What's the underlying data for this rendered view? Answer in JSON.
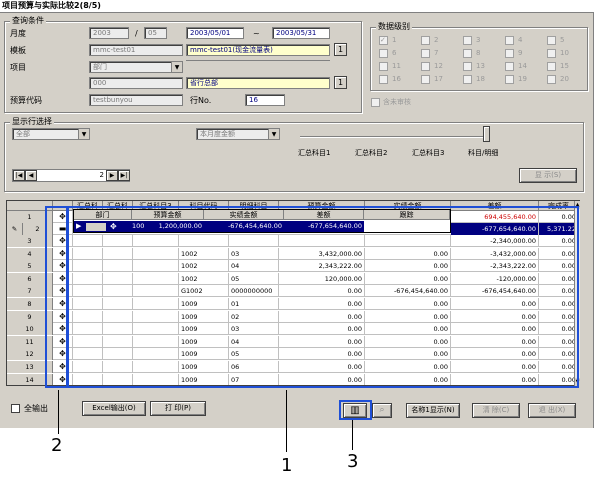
{
  "window": {
    "title": "项目预算与实际比较2(8/5)"
  },
  "query": {
    "group_title": "查询条件",
    "month_label": "月度",
    "year_value": "2003",
    "slash": "/",
    "month_value": "05",
    "date_from": "2003/05/01",
    "tilde": "~",
    "date_to": "2003/05/31",
    "template_label": "模板",
    "template_code": "mmc-test01",
    "template_name": "mmc-test01(现金流量表)",
    "project_label": "项目",
    "project_select": "部门",
    "project_code": "000",
    "project_name": "省行总部",
    "budget_code_label": "预算代码",
    "budget_code": "testbunyou",
    "row_no_label": "行No.",
    "row_no": "16",
    "lookup_label": "1"
  },
  "data_level": {
    "title": "数据级别",
    "levels": [
      "1",
      "2",
      "3",
      "4",
      "5",
      "6",
      "7",
      "8",
      "9",
      "10",
      "11",
      "12",
      "13",
      "14",
      "15",
      "16",
      "17",
      "18",
      "19",
      "20"
    ],
    "checked": [
      "1"
    ],
    "unaudited_label": "含未审核"
  },
  "display": {
    "title": "显示行选择",
    "select_all": "全部",
    "amount_type": "本月度金额",
    "slider_labels": [
      "汇总科目1",
      "汇总科目2",
      "汇总科目3",
      "科目/明细"
    ],
    "nav_value": "2",
    "show_button": "显 示(S)"
  },
  "grid": {
    "headers": [
      "",
      "",
      "汇总科",
      "汇总科",
      "汇总科目3",
      "科目代码",
      "明细科目",
      "预算金额",
      "实绩金额",
      "差额",
      "完成率"
    ],
    "sub_headers": [
      "部门",
      "预算金额",
      "实绩金额",
      "差额",
      "跟踪"
    ],
    "sub_row": {
      "code": "100",
      "budget": "1,200,000.00",
      "actual": "-676,454,640.00",
      "diff": "-677,654,640.00"
    },
    "row1_diff": "694,455,640.00",
    "row1_rate": "0.00",
    "row2_diff": "-677,654,640.00",
    "row2_rate": "5,371.22",
    "rows": [
      {
        "no": "3",
        "code": "",
        "detail": "",
        "budget": "",
        "actual": "",
        "diff": "-2,340,000.00",
        "rate": "0.00"
      },
      {
        "no": "4",
        "code": "1002",
        "detail": "03",
        "budget": "3,432,000.00",
        "actual": "0.00",
        "diff": "-3,432,000.00",
        "rate": "0.00"
      },
      {
        "no": "5",
        "code": "1002",
        "detail": "04",
        "budget": "2,343,222.00",
        "actual": "0.00",
        "diff": "-2,343,222.00",
        "rate": "0.00"
      },
      {
        "no": "6",
        "code": "1002",
        "detail": "05",
        "budget": "120,000.00",
        "actual": "0.00",
        "diff": "-120,000.00",
        "rate": "0.00"
      },
      {
        "no": "7",
        "code": "G1002",
        "detail": "0000000000",
        "budget": "0.00",
        "actual": "-676,454,640.00",
        "diff": "-676,454,640.00",
        "rate": "0.00"
      },
      {
        "no": "8",
        "code": "1009",
        "detail": "01",
        "budget": "0.00",
        "actual": "0.00",
        "diff": "0.00",
        "rate": "0.00"
      },
      {
        "no": "9",
        "code": "1009",
        "detail": "02",
        "budget": "0.00",
        "actual": "0.00",
        "diff": "0.00",
        "rate": "0.00"
      },
      {
        "no": "10",
        "code": "1009",
        "detail": "03",
        "budget": "0.00",
        "actual": "0.00",
        "diff": "0.00",
        "rate": "0.00"
      },
      {
        "no": "11",
        "code": "1009",
        "detail": "04",
        "budget": "0.00",
        "actual": "0.00",
        "diff": "0.00",
        "rate": "0.00"
      },
      {
        "no": "12",
        "code": "1009",
        "detail": "05",
        "budget": "0.00",
        "actual": "0.00",
        "diff": "0.00",
        "rate": "0.00"
      },
      {
        "no": "13",
        "code": "1009",
        "detail": "06",
        "budget": "0.00",
        "actual": "0.00",
        "diff": "0.00",
        "rate": "0.00"
      },
      {
        "no": "14",
        "code": "1009",
        "detail": "07",
        "budget": "0.00",
        "actual": "0.00",
        "diff": "0.00",
        "rate": "0.00"
      }
    ]
  },
  "bottom": {
    "all_output": "全输出",
    "excel_button": "Excel输出(O)",
    "print_button": "打 印(P)",
    "name_display_button": "名称1显示(N)",
    "clear_button": "清 除(C)",
    "exit_button": "退 出(X)"
  },
  "annotations": {
    "a1": "1",
    "a2": "2",
    "a3": "3"
  },
  "colors": {
    "selected_row": "#000080",
    "red_value": "#cc0000",
    "annotation_blue": "#1f4fd6"
  }
}
